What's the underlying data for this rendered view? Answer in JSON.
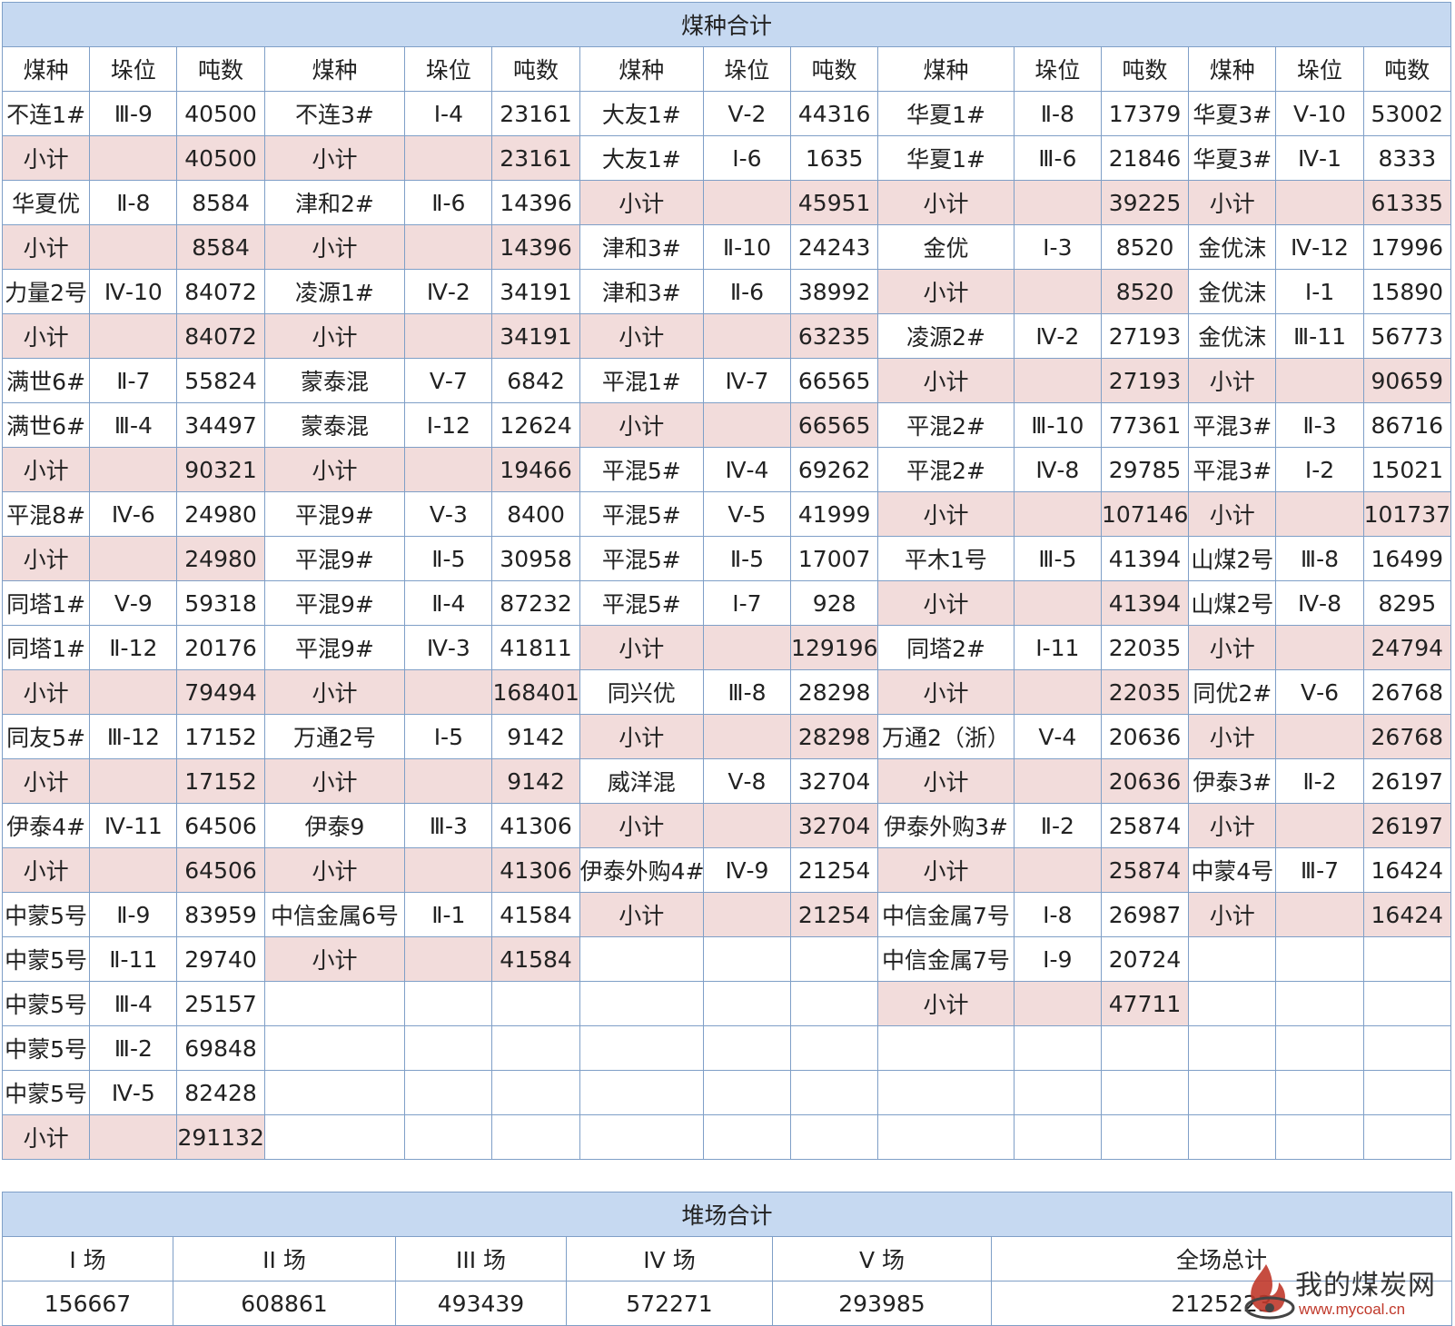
{
  "header": {
    "title": "煤种合计",
    "labels": [
      "煤种",
      "垛位",
      "吨数"
    ]
  },
  "rows": [
    [
      [
        "不连1#",
        "Ⅲ-9",
        "40500",
        0
      ],
      [
        "不连3#",
        "Ⅰ-4",
        "23161",
        0
      ],
      [
        "大友1#",
        "Ⅴ-2",
        "44316",
        0
      ],
      [
        "华夏1#",
        "Ⅱ-8",
        "17379",
        0
      ],
      [
        "华夏3#",
        "Ⅴ-10",
        "53002",
        0
      ]
    ],
    [
      [
        "小计",
        "",
        "40500",
        1
      ],
      [
        "小计",
        "",
        "23161",
        1
      ],
      [
        "大友1#",
        "Ⅰ-6",
        "1635",
        0
      ],
      [
        "华夏1#",
        "Ⅲ-6",
        "21846",
        0
      ],
      [
        "华夏3#",
        "Ⅳ-1",
        "8333",
        0
      ]
    ],
    [
      [
        "华夏优",
        "Ⅱ-8",
        "8584",
        0
      ],
      [
        "津和2#",
        "Ⅱ-6",
        "14396",
        0
      ],
      [
        "小计",
        "",
        "45951",
        1
      ],
      [
        "小计",
        "",
        "39225",
        1
      ],
      [
        "小计",
        "",
        "61335",
        1
      ]
    ],
    [
      [
        "小计",
        "",
        "8584",
        1
      ],
      [
        "小计",
        "",
        "14396",
        1
      ],
      [
        "津和3#",
        "Ⅱ-10",
        "24243",
        0
      ],
      [
        "金优",
        "Ⅰ-3",
        "8520",
        0
      ],
      [
        "金优沫",
        "Ⅳ-12",
        "17996",
        0
      ]
    ],
    [
      [
        "力量2号",
        "Ⅳ-10",
        "84072",
        0
      ],
      [
        "凌源1#",
        "Ⅳ-2",
        "34191",
        0
      ],
      [
        "津和3#",
        "Ⅱ-6",
        "38992",
        0
      ],
      [
        "小计",
        "",
        "8520",
        1
      ],
      [
        "金优沫",
        "Ⅰ-1",
        "15890",
        0
      ]
    ],
    [
      [
        "小计",
        "",
        "84072",
        1
      ],
      [
        "小计",
        "",
        "34191",
        1
      ],
      [
        "小计",
        "",
        "63235",
        1
      ],
      [
        "凌源2#",
        "Ⅳ-2",
        "27193",
        0
      ],
      [
        "金优沫",
        "Ⅲ-11",
        "56773",
        0
      ]
    ],
    [
      [
        "满世6#",
        "Ⅱ-7",
        "55824",
        0
      ],
      [
        "蒙泰混",
        "Ⅴ-7",
        "6842",
        0
      ],
      [
        "平混1#",
        "Ⅳ-7",
        "66565",
        0
      ],
      [
        "小计",
        "",
        "27193",
        1
      ],
      [
        "小计",
        "",
        "90659",
        1
      ]
    ],
    [
      [
        "满世6#",
        "Ⅲ-4",
        "34497",
        0
      ],
      [
        "蒙泰混",
        "Ⅰ-12",
        "12624",
        0
      ],
      [
        "小计",
        "",
        "66565",
        1
      ],
      [
        "平混2#",
        "Ⅲ-10",
        "77361",
        0
      ],
      [
        "平混3#",
        "Ⅱ-3",
        "86716",
        0
      ]
    ],
    [
      [
        "小计",
        "",
        "90321",
        1
      ],
      [
        "小计",
        "",
        "19466",
        1
      ],
      [
        "平混5#",
        "Ⅳ-4",
        "69262",
        0
      ],
      [
        "平混2#",
        "Ⅳ-8",
        "29785",
        0
      ],
      [
        "平混3#",
        "Ⅰ-2",
        "15021",
        0
      ]
    ],
    [
      [
        "平混8#",
        "Ⅳ-6",
        "24980",
        0
      ],
      [
        "平混9#",
        "Ⅴ-3",
        "8400",
        0
      ],
      [
        "平混5#",
        "Ⅴ-5",
        "41999",
        0
      ],
      [
        "小计",
        "",
        "107146",
        1
      ],
      [
        "小计",
        "",
        "101737",
        1
      ]
    ],
    [
      [
        "小计",
        "",
        "24980",
        1
      ],
      [
        "平混9#",
        "Ⅱ-5",
        "30958",
        0
      ],
      [
        "平混5#",
        "Ⅱ-5",
        "17007",
        0
      ],
      [
        "平木1号",
        "Ⅲ-5",
        "41394",
        0
      ],
      [
        "山煤2号",
        "Ⅲ-8",
        "16499",
        0
      ]
    ],
    [
      [
        "同塔1#",
        "Ⅴ-9",
        "59318",
        0
      ],
      [
        "平混9#",
        "Ⅱ-4",
        "87232",
        0
      ],
      [
        "平混5#",
        "Ⅰ-7",
        "928",
        0
      ],
      [
        "小计",
        "",
        "41394",
        1
      ],
      [
        "山煤2号",
        "Ⅳ-8",
        "8295",
        0
      ]
    ],
    [
      [
        "同塔1#",
        "Ⅱ-12",
        "20176",
        0
      ],
      [
        "平混9#",
        "Ⅳ-3",
        "41811",
        0
      ],
      [
        "小计",
        "",
        "129196",
        1
      ],
      [
        "同塔2#",
        "Ⅰ-11",
        "22035",
        0
      ],
      [
        "小计",
        "",
        "24794",
        1
      ]
    ],
    [
      [
        "小计",
        "",
        "79494",
        1
      ],
      [
        "小计",
        "",
        "168401",
        1
      ],
      [
        "同兴优",
        "Ⅲ-8",
        "28298",
        0
      ],
      [
        "小计",
        "",
        "22035",
        1
      ],
      [
        "同优2#",
        "Ⅴ-6",
        "26768",
        0
      ]
    ],
    [
      [
        "同友5#",
        "Ⅲ-12",
        "17152",
        0
      ],
      [
        "万通2号",
        "Ⅰ-5",
        "9142",
        0
      ],
      [
        "小计",
        "",
        "28298",
        1
      ],
      [
        "万通2（浙）",
        "Ⅴ-4",
        "20636",
        0
      ],
      [
        "小计",
        "",
        "26768",
        1
      ]
    ],
    [
      [
        "小计",
        "",
        "17152",
        1
      ],
      [
        "小计",
        "",
        "9142",
        1
      ],
      [
        "威洋混",
        "Ⅴ-8",
        "32704",
        0
      ],
      [
        "小计",
        "",
        "20636",
        1
      ],
      [
        "伊泰3#",
        "Ⅱ-2",
        "26197",
        0
      ]
    ],
    [
      [
        "伊泰4#",
        "Ⅳ-11",
        "64506",
        0
      ],
      [
        "伊泰9",
        "Ⅲ-3",
        "41306",
        0
      ],
      [
        "小计",
        "",
        "32704",
        1
      ],
      [
        "伊泰外购3#",
        "Ⅱ-2",
        "25874",
        0
      ],
      [
        "小计",
        "",
        "26197",
        1
      ]
    ],
    [
      [
        "小计",
        "",
        "64506",
        1
      ],
      [
        "小计",
        "",
        "41306",
        1
      ],
      [
        "伊泰外购4#",
        "Ⅳ-9",
        "21254",
        0
      ],
      [
        "小计",
        "",
        "25874",
        1
      ],
      [
        "中蒙4号",
        "Ⅲ-7",
        "16424",
        0
      ]
    ],
    [
      [
        "中蒙5号",
        "Ⅱ-9",
        "83959",
        0
      ],
      [
        "中信金属6号",
        "Ⅱ-1",
        "41584",
        0
      ],
      [
        "小计",
        "",
        "21254",
        1
      ],
      [
        "中信金属7号",
        "Ⅰ-8",
        "26987",
        0
      ],
      [
        "小计",
        "",
        "16424",
        1
      ]
    ],
    [
      [
        "中蒙5号",
        "Ⅱ-11",
        "29740",
        0
      ],
      [
        "小计",
        "",
        "41584",
        1
      ],
      [
        "",
        "",
        "",
        0
      ],
      [
        "中信金属7号",
        "Ⅰ-9",
        "20724",
        0
      ],
      [
        "",
        "",
        "",
        0
      ]
    ],
    [
      [
        "中蒙5号",
        "Ⅲ-4",
        "25157",
        0
      ],
      [
        "",
        "",
        "",
        0
      ],
      [
        "",
        "",
        "",
        0
      ],
      [
        "小计",
        "",
        "47711",
        1
      ],
      [
        "",
        "",
        "",
        0
      ]
    ],
    [
      [
        "中蒙5号",
        "Ⅲ-2",
        "69848",
        0
      ],
      [
        "",
        "",
        "",
        0
      ],
      [
        "",
        "",
        "",
        0
      ],
      [
        "",
        "",
        "",
        0
      ],
      [
        "",
        "",
        "",
        0
      ]
    ],
    [
      [
        "中蒙5号",
        "Ⅳ-5",
        "82428",
        0
      ],
      [
        "",
        "",
        "",
        0
      ],
      [
        "",
        "",
        "",
        0
      ],
      [
        "",
        "",
        "",
        0
      ],
      [
        "",
        "",
        "",
        0
      ]
    ],
    [
      [
        "小计",
        "",
        "291132",
        1
      ],
      [
        "",
        "",
        "",
        0
      ],
      [
        "",
        "",
        "",
        0
      ],
      [
        "",
        "",
        "",
        0
      ],
      [
        "",
        "",
        "",
        0
      ]
    ]
  ],
  "yard": {
    "title": "堆场合计",
    "headers": [
      "I 场",
      "II 场",
      "III 场",
      "IV 场",
      "V 场",
      "全场总计"
    ],
    "values": [
      "156667",
      "608861",
      "493439",
      "572271",
      "293985",
      "2125223"
    ]
  },
  "watermark": {
    "name": "我的煤炭网",
    "url": "www.mycoal.cn",
    "accent": "#c0392b"
  }
}
